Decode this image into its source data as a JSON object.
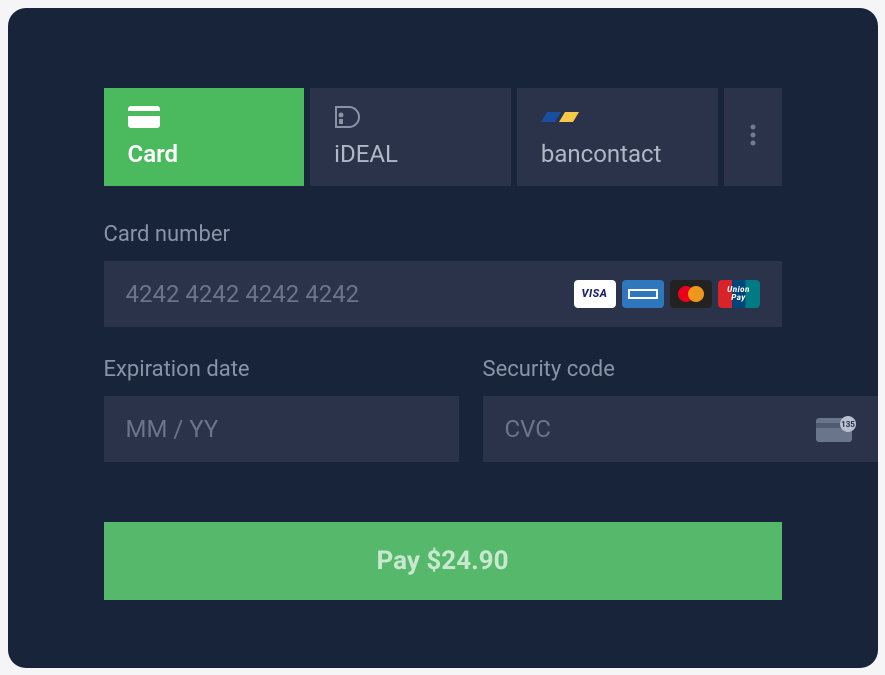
{
  "payment_methods": {
    "tabs": [
      {
        "id": "card",
        "label": "Card",
        "active": true
      },
      {
        "id": "ideal",
        "label": "iDEAL",
        "active": false
      },
      {
        "id": "bancontact",
        "label": "bancontact",
        "active": false
      }
    ],
    "more_icon": "more-vertical-icon"
  },
  "card_form": {
    "number": {
      "label": "Card number",
      "placeholder": "4242 4242 4242 4242",
      "value": ""
    },
    "expiration": {
      "label": "Expiration date",
      "placeholder": "MM / YY",
      "value": ""
    },
    "cvc": {
      "label": "Security code",
      "placeholder": "CVC",
      "value": ""
    },
    "card_brands": [
      "visa",
      "amex",
      "mastercard",
      "unionpay"
    ]
  },
  "pay_button": {
    "label": "Pay $24.90",
    "amount": 24.9,
    "currency": "USD"
  },
  "colors": {
    "panel_bg": "#18243a",
    "input_bg": "#2a3349",
    "accent_green": "#4bb95e",
    "muted_text": "#8a93a6"
  }
}
